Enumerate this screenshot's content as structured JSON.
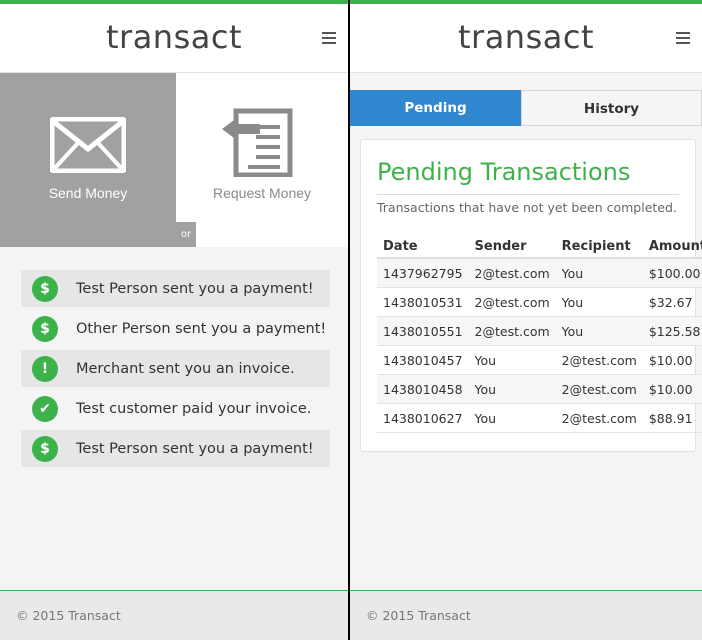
{
  "brand": "transact",
  "left": {
    "send_label": "Send Money",
    "request_label": "Request Money",
    "or_label": "or",
    "feed": [
      {
        "icon": "dollar-icon",
        "glyph": "$",
        "text": "Test Person sent you a payment!"
      },
      {
        "icon": "dollar-icon",
        "glyph": "$",
        "text": "Other Person sent you a payment!"
      },
      {
        "icon": "exclamation-icon",
        "glyph": "!",
        "text": "Merchant sent you an invoice."
      },
      {
        "icon": "check-icon",
        "glyph": "✔",
        "text": "Test customer paid your invoice."
      },
      {
        "icon": "dollar-icon",
        "glyph": "$",
        "text": "Test Person sent you a payment!"
      }
    ]
  },
  "right": {
    "tabs": [
      {
        "label": "Pending",
        "active": true
      },
      {
        "label": "History",
        "active": false
      }
    ],
    "title": "Pending Transactions",
    "subtitle": "Transactions that have not yet been completed.",
    "columns": [
      "Date",
      "Sender",
      "Recipient",
      "Amount"
    ],
    "rows": [
      [
        "1437962795",
        "2@test.com",
        "You",
        "$100.00"
      ],
      [
        "1438010531",
        "2@test.com",
        "You",
        "$32.67"
      ],
      [
        "1438010551",
        "2@test.com",
        "You",
        "$125.58"
      ],
      [
        "1438010457",
        "You",
        "2@test.com",
        "$10.00"
      ],
      [
        "1438010458",
        "You",
        "2@test.com",
        "$10.00"
      ],
      [
        "1438010627",
        "You",
        "2@test.com",
        "$88.91"
      ]
    ]
  },
  "footer": "© 2015 Transact",
  "colors": {
    "accent_green": "#3cb34a",
    "tab_blue": "#2f87d0",
    "tile_gray": "#a1a1a1"
  }
}
